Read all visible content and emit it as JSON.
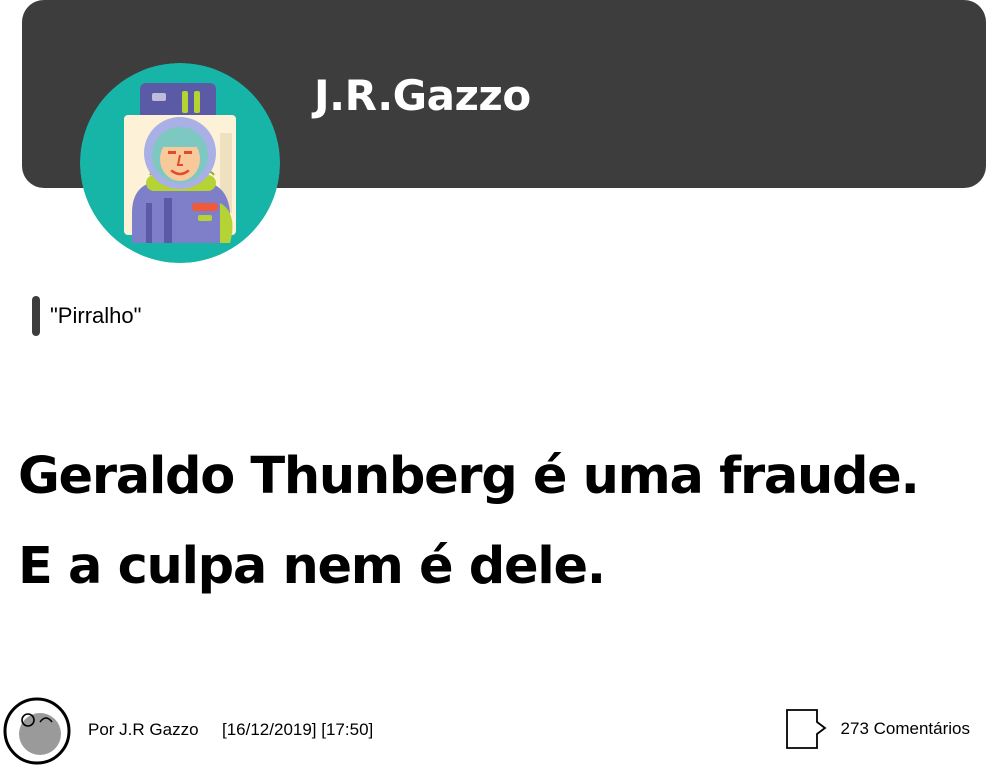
{
  "header": {
    "blog_title": "J.R.Gazzo",
    "background_color": "#3d3d3d",
    "avatar_icon": "astronaut-avatar-icon"
  },
  "post": {
    "tag": "\"Pirralho\"",
    "headline_line1": "Geraldo Thunberg é uma fraude.",
    "headline_line2": "E a culpa nem é dele."
  },
  "footer": {
    "author": "Por J.R Gazzo",
    "datetime": "[16/12/2019] [17:50]",
    "comments": "273 Comentários",
    "author_avatar_icon": "author-avatar-icon",
    "comment_icon": "speech-bubble-icon"
  },
  "colors": {
    "avatar_bg": "#17b4a8",
    "header_text": "#ffffff"
  }
}
